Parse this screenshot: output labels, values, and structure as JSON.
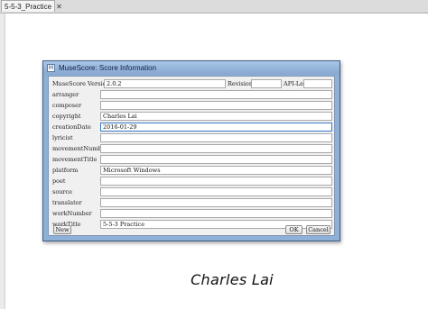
{
  "tab": {
    "label": "5-5-3_Practice",
    "close": "✕"
  },
  "score": {
    "composer_text": "Charles Lai"
  },
  "dialog": {
    "app_icon": "M",
    "title": "MuseScore: Score Information",
    "version_label": "MuseScore Version:",
    "version_value": "2.0.2",
    "revision_label": "Revision: 0",
    "api_label": "API-Level: 206",
    "fields": [
      {
        "label": "arranger",
        "value": ""
      },
      {
        "label": "composer",
        "value": ""
      },
      {
        "label": "copyright",
        "value": "Charles Lai"
      },
      {
        "label": "creationDate",
        "value": "2016-01-29"
      },
      {
        "label": "lyricist",
        "value": ""
      },
      {
        "label": "movementNumber",
        "value": ""
      },
      {
        "label": "movementTitle",
        "value": ""
      },
      {
        "label": "platform",
        "value": "Microsoft Windows"
      },
      {
        "label": "poet",
        "value": ""
      },
      {
        "label": "source",
        "value": ""
      },
      {
        "label": "translator",
        "value": ""
      },
      {
        "label": "workNumber",
        "value": ""
      },
      {
        "label": "workTitle",
        "value": "5-5-3 Practice"
      }
    ],
    "buttons": {
      "new": "New",
      "ok": "OK",
      "cancel": "Cancel"
    }
  }
}
